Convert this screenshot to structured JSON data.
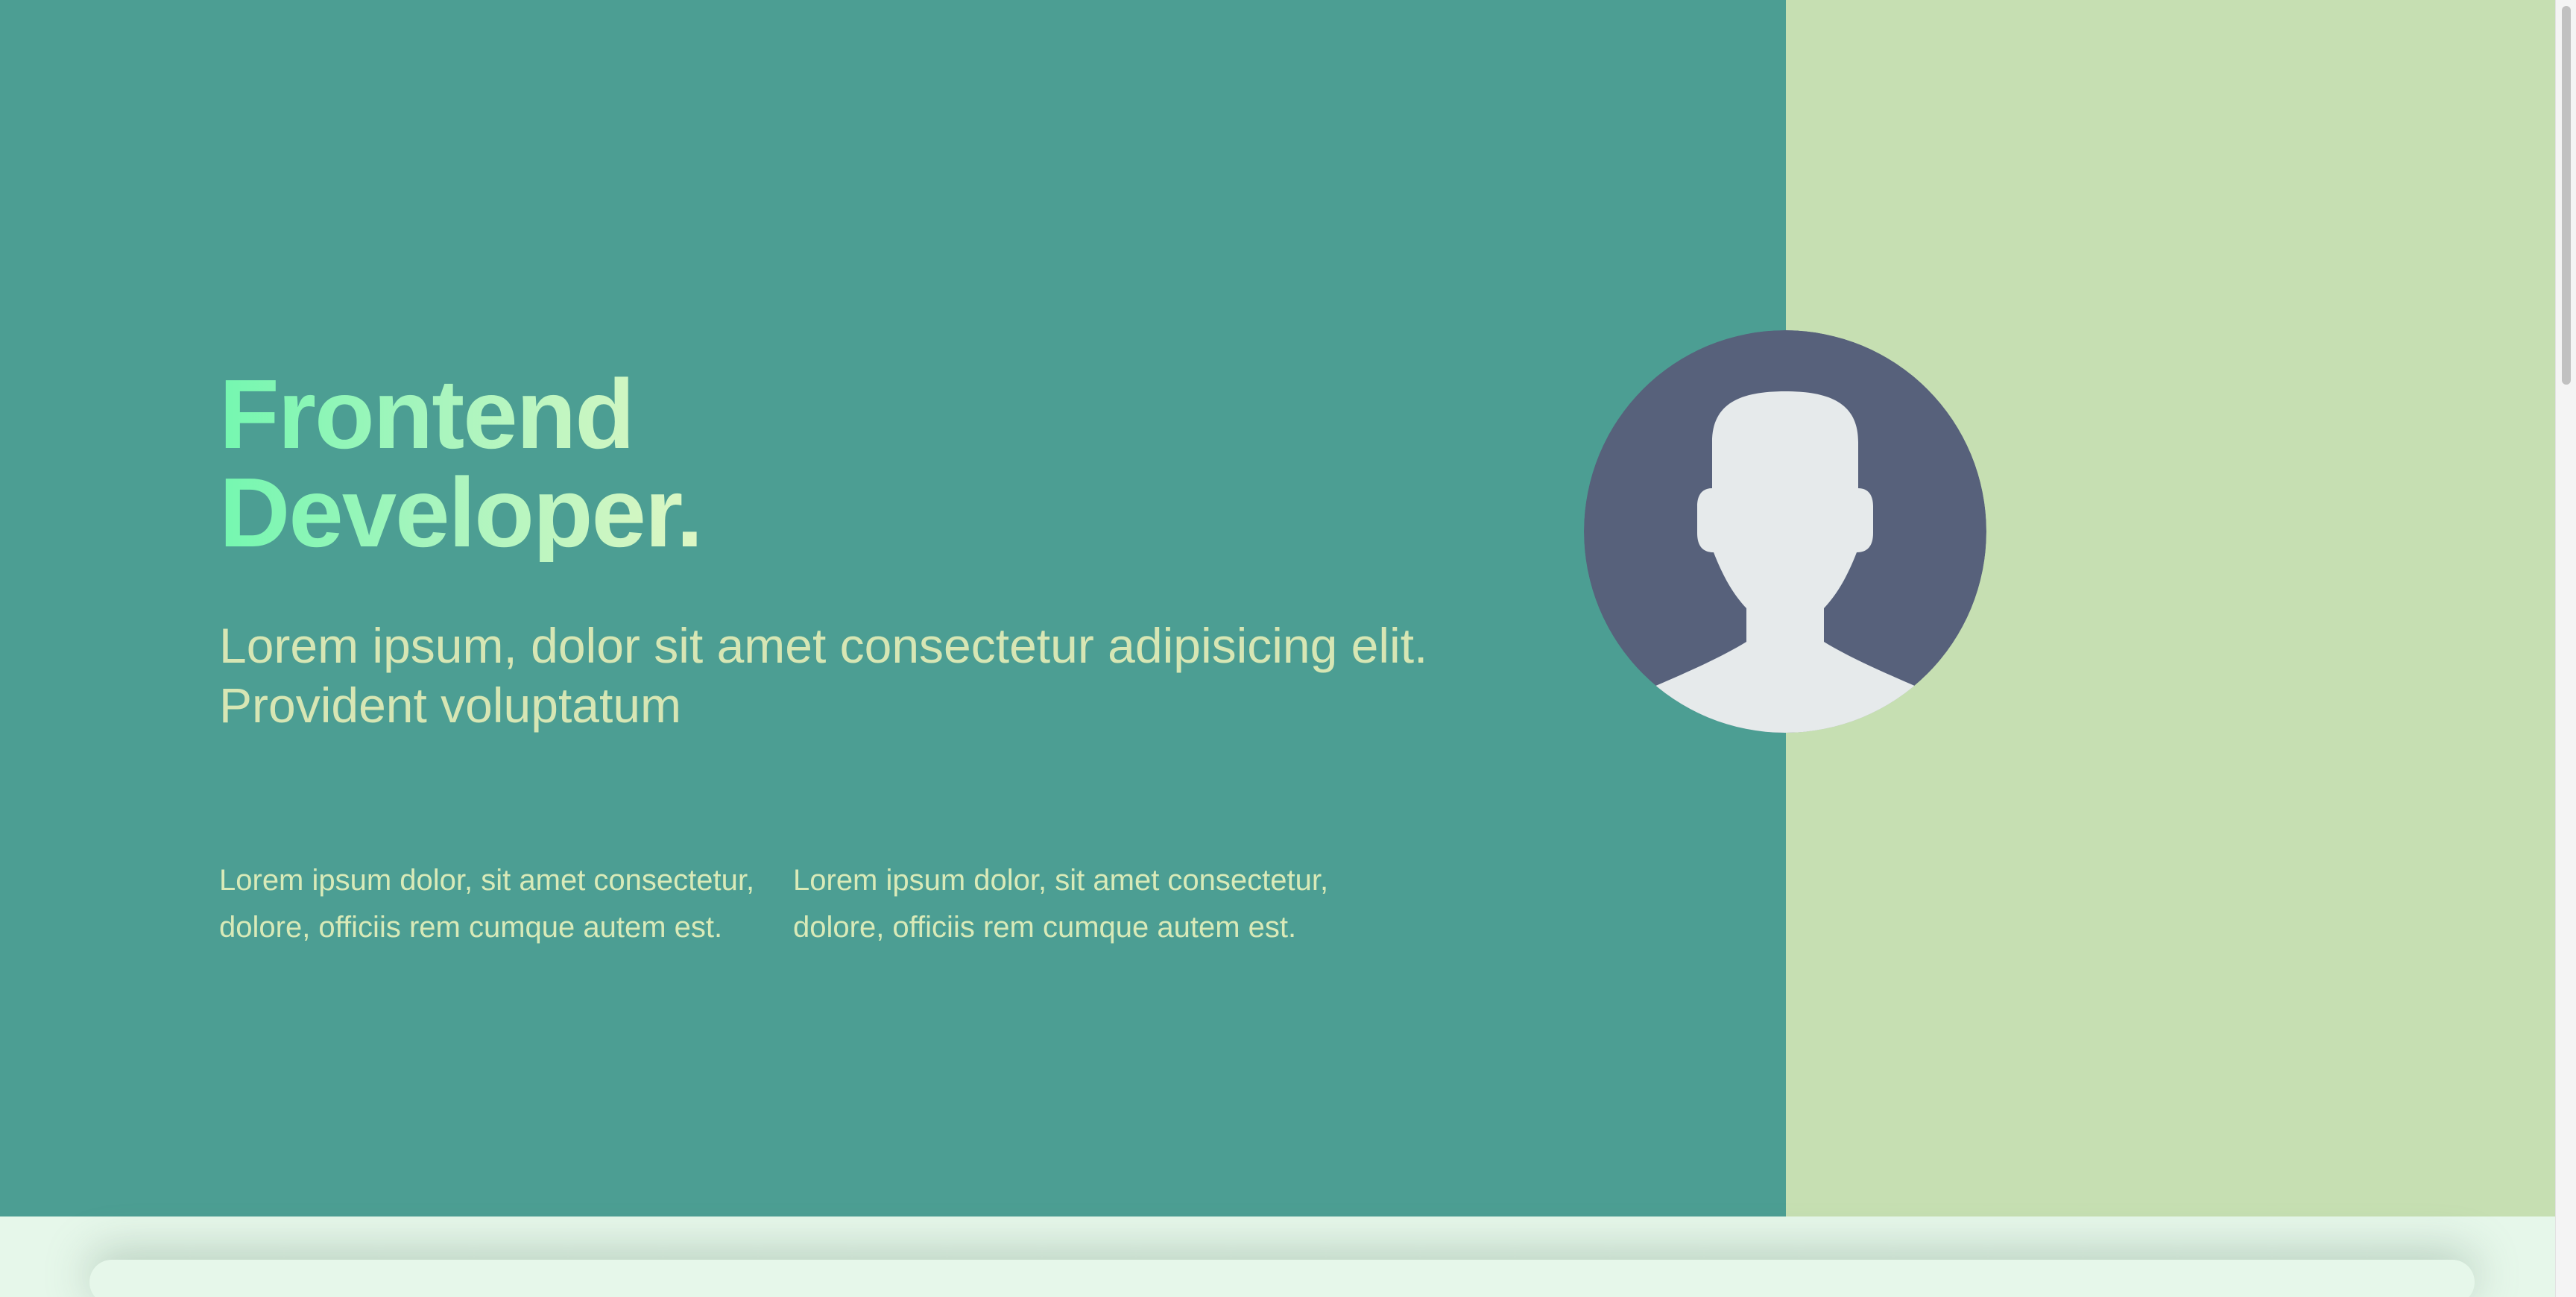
{
  "hero": {
    "headline_line1": "Frontend",
    "headline_line2": "Developer.",
    "subtitle": "Lorem ipsum, dolor sit amet consectetur adipisicing elit. Provident voluptatum",
    "paragraphs": [
      "Lorem ipsum dolor, sit amet consectetur, dolore, officiis rem cumque autem est.",
      "Lorem ipsum dolor, sit amet consectetur, dolore, officiis rem cumque autem est."
    ],
    "avatar_icon": "user-avatar-icon"
  },
  "colors": {
    "left_panel": "#4c9e93",
    "right_panel": "#c6dfb2",
    "next_section": "#e6f7ea",
    "headline_gradient_start": "#74f7b0",
    "headline_gradient_end": "#def7c4",
    "avatar_background": "#57617b",
    "avatar_silhouette": "#e6eaeb"
  }
}
